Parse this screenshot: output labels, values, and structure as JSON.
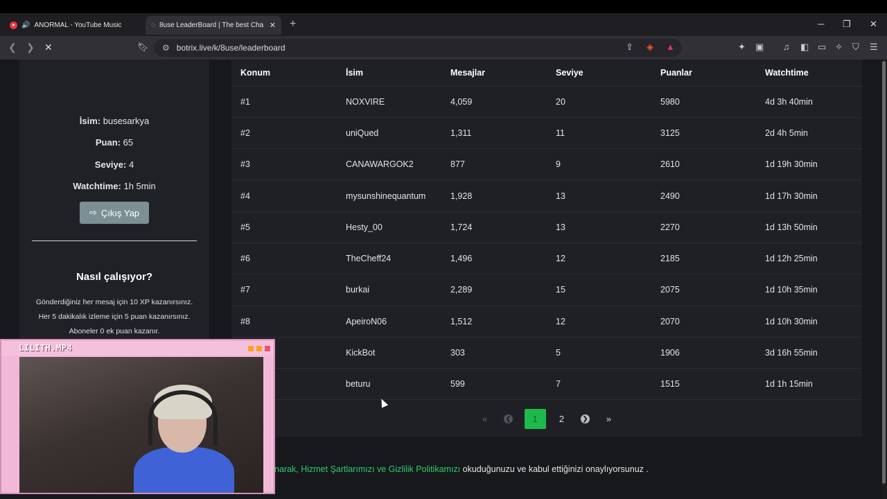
{
  "browser": {
    "tabs": [
      {
        "title": "ANORMAL - YouTube Music",
        "active": false
      },
      {
        "title": "8use LeaderBoard | The best Cha",
        "active": true
      }
    ],
    "url": "botrix.live/k/8use/leaderboard"
  },
  "sidebar": {
    "name_label": "İsim:",
    "name_value": "busesarkya",
    "points_label": "Puan:",
    "points_value": "65",
    "level_label": "Seviye:",
    "level_value": "4",
    "watchtime_label": "Watchtime:",
    "watchtime_value": "1h 5min",
    "logout_label": "Çıkış Yap",
    "how_title": "Nasıl çalışıyor?",
    "how_lines": [
      "Gönderdiğiniz her mesaj için 10 XP kazanırsınız.",
      "Her 5 dakikalık izleme için 5 puan kazanırsınız.",
      "Aboneler 0 ek puan kazanır."
    ]
  },
  "leaderboard": {
    "columns": [
      "Konum",
      "İsim",
      "Mesajlar",
      "Seviye",
      "Puanlar",
      "Watchtime"
    ],
    "rows": [
      {
        "rank": "#1",
        "name": "NOXVIRE",
        "messages": "4,059",
        "level": "20",
        "points": "5980",
        "watchtime": "4d 3h 40min"
      },
      {
        "rank": "#2",
        "name": "uniQued",
        "messages": "1,311",
        "level": "11",
        "points": "3125",
        "watchtime": "2d 4h 5min"
      },
      {
        "rank": "#3",
        "name": "CANAWARGOK2",
        "messages": "877",
        "level": "9",
        "points": "2610",
        "watchtime": "1d 19h 30min"
      },
      {
        "rank": "#4",
        "name": "mysunshinequantum",
        "messages": "1,928",
        "level": "13",
        "points": "2490",
        "watchtime": "1d 17h 30min"
      },
      {
        "rank": "#5",
        "name": "Hesty_00",
        "messages": "1,724",
        "level": "13",
        "points": "2270",
        "watchtime": "1d 13h 50min"
      },
      {
        "rank": "#6",
        "name": "TheCheff24",
        "messages": "1,496",
        "level": "12",
        "points": "2185",
        "watchtime": "1d 12h 25min"
      },
      {
        "rank": "#7",
        "name": "burkai",
        "messages": "2,289",
        "level": "15",
        "points": "2075",
        "watchtime": "1d 10h 35min"
      },
      {
        "rank": "#8",
        "name": "ApeiroN06",
        "messages": "1,512",
        "level": "12",
        "points": "2070",
        "watchtime": "1d 10h 30min"
      },
      {
        "rank": "",
        "name": "KickBot",
        "messages": "303",
        "level": "5",
        "points": "1906",
        "watchtime": "3d 16h 55min"
      },
      {
        "rank": "",
        "name": "beturu",
        "messages": "599",
        "level": "7",
        "points": "1515",
        "watchtime": "1d 1h 15min"
      }
    ],
    "pagination": {
      "current": "1",
      "next": "2"
    }
  },
  "footer": {
    "prefix": "narak, ",
    "link1": "Hizmet Şartlarımızı",
    "mid": " ve ",
    "link2": "Gizlilik Politikamızı",
    "suffix": " okuduğunuzu ve kabul ettiğinizi onaylıyorsunuz ."
  },
  "webcam": {
    "title": "LILITH.MP4"
  },
  "colors": {
    "accent": "#1fb84b",
    "link": "#2ecc71",
    "webcam_frame": "#f2b8d8"
  }
}
